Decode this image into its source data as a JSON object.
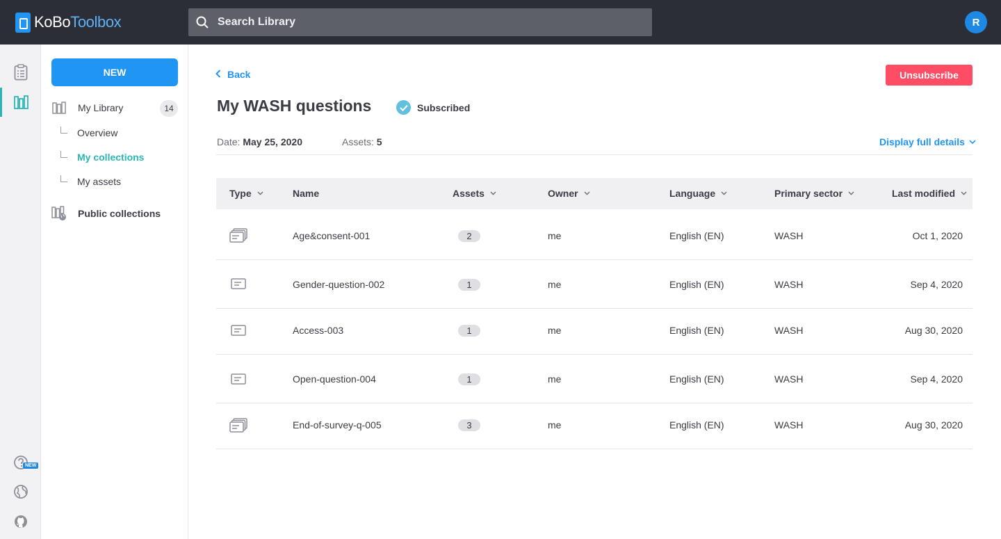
{
  "header": {
    "logo_left": "KoBo",
    "logo_right": "Toolbox",
    "search_placeholder": "Search Library",
    "avatar_initial": "R"
  },
  "rail": {
    "new_badge": "NEW"
  },
  "sidebar": {
    "new_button": "NEW",
    "my_library": "My Library",
    "my_library_count": "14",
    "sub_items": [
      "Overview",
      "My collections",
      "My assets"
    ],
    "active_sub": "My collections",
    "public_collections": "Public collections"
  },
  "main": {
    "back_label": "Back",
    "unsubscribe_label": "Unsubscribe",
    "title": "My WASH questions",
    "status": "Subscribed",
    "date_label": "Date:",
    "date_value": "May 25, 2020",
    "assets_label": "Assets:",
    "assets_value": "5",
    "details_label": "Display full details"
  },
  "table": {
    "columns": [
      "Type",
      "Name",
      "Assets",
      "Owner",
      "Language",
      "Primary sector",
      "Last modified"
    ],
    "rows": [
      {
        "type_icon": "block-icon",
        "name": "Age&consent-001",
        "assets": "2",
        "owner": "me",
        "language": "English (EN)",
        "sector": "WASH",
        "modified": "Oct 1, 2020"
      },
      {
        "type_icon": "question-icon",
        "name": "Gender-question-002",
        "assets": "1",
        "owner": "me",
        "language": "English (EN)",
        "sector": "WASH",
        "modified": "Sep 4, 2020"
      },
      {
        "type_icon": "question-icon",
        "name": "Access-003",
        "assets": "1",
        "owner": "me",
        "language": "English (EN)",
        "sector": "WASH",
        "modified": "Aug 30, 2020"
      },
      {
        "type_icon": "question-icon",
        "name": "Open-question-004",
        "assets": "1",
        "owner": "me",
        "language": "English (EN)",
        "sector": "WASH",
        "modified": "Sep 4, 2020"
      },
      {
        "type_icon": "block-icon",
        "name": "End-of-survey-q-005",
        "assets": "3",
        "owner": "me",
        "language": "English (EN)",
        "sector": "WASH",
        "modified": "Aug 30, 2020"
      }
    ]
  },
  "colors": {
    "header_bg": "#2c2e37",
    "primary": "#2095f3",
    "teal": "#2bb6b5",
    "danger": "#ff4d65"
  }
}
